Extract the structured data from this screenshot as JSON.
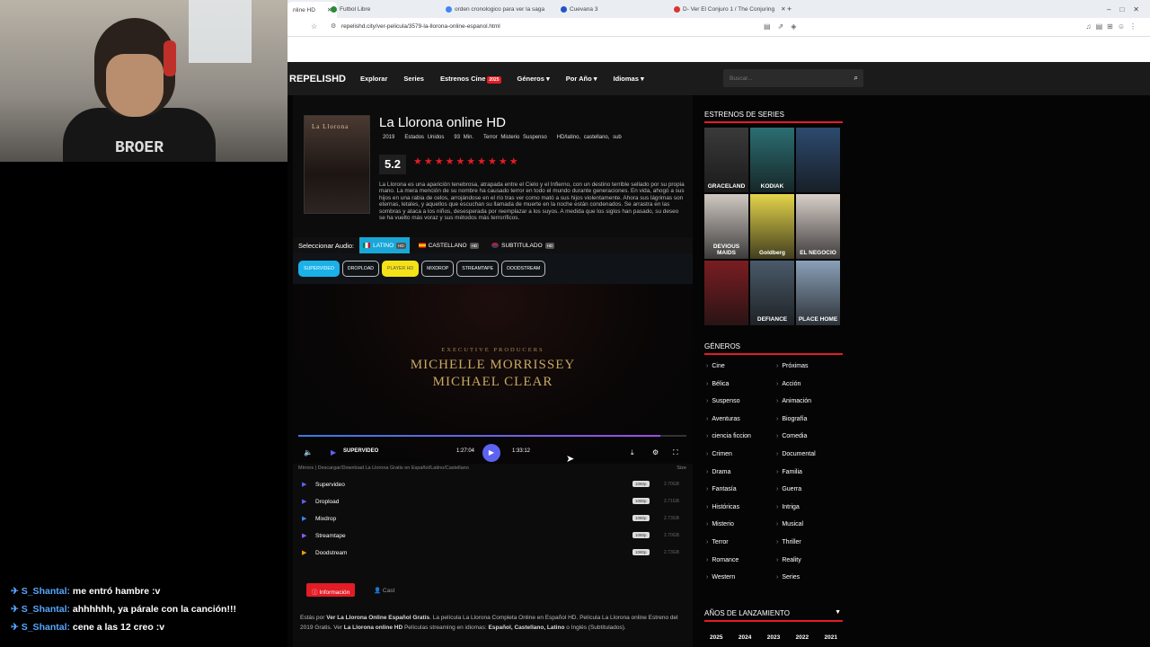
{
  "chat": [
    {
      "user": "S_Shantal:",
      "msg": "me entró hambre :v"
    },
    {
      "user": "S_Shantal:",
      "msg": "ahhhhhh, ya párale con la canción!!!"
    },
    {
      "user": "S_Shantal:",
      "msg": "cene a las 12 creo :v"
    }
  ],
  "webcam": {
    "shirt_text": "BROER"
  },
  "browser": {
    "tabs": [
      {
        "label": "nline HD"
      },
      {
        "label": "Futbol Libre"
      },
      {
        "label": "orden cronologico para ver la saga"
      },
      {
        "label": "Cuevana 3"
      },
      {
        "label": "D- Ver El Conjuro 1 / The Conjuring"
      }
    ],
    "url": "repelishd.city/ver-pelicula/3579-la-llorona-online-espanol.html"
  },
  "nav": {
    "logo": "REPELISHD",
    "items": [
      "Explorar",
      "Series",
      "Estrenos Cine",
      "Géneros ▾",
      "Por Año ▾",
      "Idiomas ▾"
    ],
    "estrenos_badge": "2025",
    "search_placeholder": "Buscar..."
  },
  "movie": {
    "poster_title": "La Llorona",
    "title": "La Llorona online HD",
    "year": "2019",
    "country": "Estados Unidos",
    "duration": "93 Min.",
    "genres": "Terror Misterio Suspenso",
    "quality": "HD/latino, castellano, sub",
    "rating": "5.2",
    "stars": "★★★★★★★★★★",
    "synopsis": "La Llorona es una aparición tenebrosa, atrapada entre el Cielo y el Infierno, con un destino terrible sellado por su propia mano. La mera mención de su nombre ha causado terror en todo el mundo durante generaciones. En vida, ahogó a sus hijos en una rabia de celos, arrojándose en el río tras ver como mató a sus hijos violentamente. Ahora sus lágrimas son eternas, letales, y aquellos que escuchan su llamada de muerte en la noche están condenados. Se arrastra en las sombras y ataca a los niños, desesperada por reemplazar a los suyos. A medida que los siglos han pasado, su deseo se ha vuelto más voraz y sus métodos más terroríficos."
  },
  "audio": {
    "label": "Seleccionar Audio:",
    "options": [
      "LATINO",
      "CASTELLANO",
      "SUBTITULADO"
    ],
    "hd": "HD"
  },
  "servers": [
    "SUPERVIDEO",
    "DROPLOAD",
    "PLAYER HD",
    "MIXDROP",
    "STREAMTAPE",
    "DOODSTREAM"
  ],
  "player": {
    "credit_small": "EXECUTIVE PRODUCERS",
    "credit_1": "MICHELLE MORRISSEY",
    "credit_2": "MICHAEL CLEAR",
    "source": "SUPERVIDEO",
    "time_current": "1:27:04",
    "time_total": "1:33:12",
    "progress": 0.934
  },
  "mirrors": {
    "header": "Mirrors | Descargar/Download La Llorona Gratis en Español/Latino/Castellano",
    "size_label": "Size",
    "items": [
      {
        "name": "Supervideo",
        "quality": "1080p",
        "size": "2.70GB",
        "color": "#5d63f0"
      },
      {
        "name": "Dropload",
        "quality": "1080p",
        "size": "2.71GB",
        "color": "#5d63f0"
      },
      {
        "name": "Mixdrop",
        "quality": "1080p",
        "size": "2.73GB",
        "color": "#3b82f6"
      },
      {
        "name": "Streamtape",
        "quality": "1080p",
        "size": "2.70GB",
        "color": "#8b5cf6"
      },
      {
        "name": "Doodstream",
        "quality": "1080p",
        "size": "2.73GB",
        "color": "#f59e0b"
      }
    ]
  },
  "info": {
    "info_label": "Información",
    "cast_label": "Cast",
    "desc_1": "Estás por ",
    "desc_b1": "Ver La Llorona Online Español Gratis",
    "desc_2": ". La película La Llorona Completa Online en Español HD. Película La Llorona online Estreno del 2019 Gratis. Ver ",
    "desc_b2": "La Llorona online HD",
    "desc_3": " Películas streaming en idiomas: ",
    "desc_b3": "Español, Castellano, Latino",
    "desc_4": " o Inglés (Subtitulados)."
  },
  "sidebar": {
    "series_heading": "ESTRENOS DE SERIES",
    "series": [
      {
        "label": "GRACELAND",
        "bg": "#3a3a3a"
      },
      {
        "label": "KODIAK",
        "bg": "#2b6f73"
      },
      {
        "label": "",
        "bg": "#2d4a6e"
      },
      {
        "label": "DEVIOUS MAIDS",
        "bg": "#cfc8c2"
      },
      {
        "label": "Goldberg",
        "bg": "#e4d44a"
      },
      {
        "label": "EL NEGOCIO",
        "bg": "#d9cfc9"
      },
      {
        "label": "",
        "bg": "#7a1d22"
      },
      {
        "label": "DEFIANCE",
        "bg": "#4a5a6a"
      },
      {
        "label": "PLACE HOME",
        "bg": "#8aa0b8"
      }
    ],
    "genres_heading": "GÉNEROS",
    "genres_left": [
      "Cine",
      "Bélica",
      "Suspenso",
      "Aventuras",
      "ciencia ficcion",
      "Crimen",
      "Drama",
      "Fantasía",
      "Históricas",
      "Misterio",
      "Terror",
      "Romance",
      "Western"
    ],
    "genres_right": [
      "Próximas",
      "Acción",
      "Animación",
      "Biografía",
      "Comedia",
      "Documental",
      "Familia",
      "Guerra",
      "Intriga",
      "Musical",
      "Thriller",
      "Reality",
      "Series"
    ],
    "years_heading": "AÑOS DE LANZAMIENTO",
    "years": [
      "2025",
      "2024",
      "2023",
      "2022",
      "2021"
    ]
  }
}
